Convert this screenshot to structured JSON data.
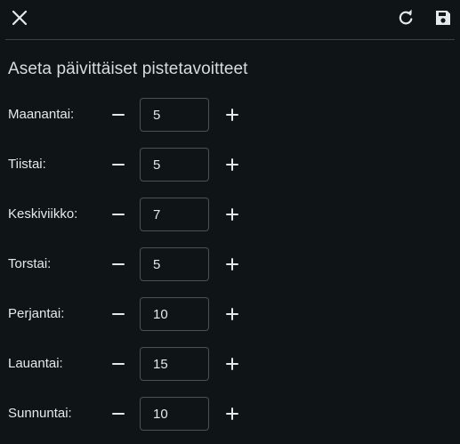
{
  "header": {
    "icons": {
      "close": "close-icon",
      "reset": "refresh-icon",
      "save": "save-icon"
    }
  },
  "title": "Aseta päivittäiset pistetavoitteet",
  "days": [
    {
      "label": "Maanantai:",
      "value": "5"
    },
    {
      "label": "Tiistai:",
      "value": "5"
    },
    {
      "label": "Keskiviikko:",
      "value": "7"
    },
    {
      "label": "Torstai:",
      "value": "5"
    },
    {
      "label": "Perjantai:",
      "value": "10"
    },
    {
      "label": "Lauantai:",
      "value": "15"
    },
    {
      "label": "Sunnuntai:",
      "value": "10"
    }
  ],
  "colors": {
    "background": "#0f1417",
    "text": "#e6e9eb",
    "border": "#4a5258"
  }
}
